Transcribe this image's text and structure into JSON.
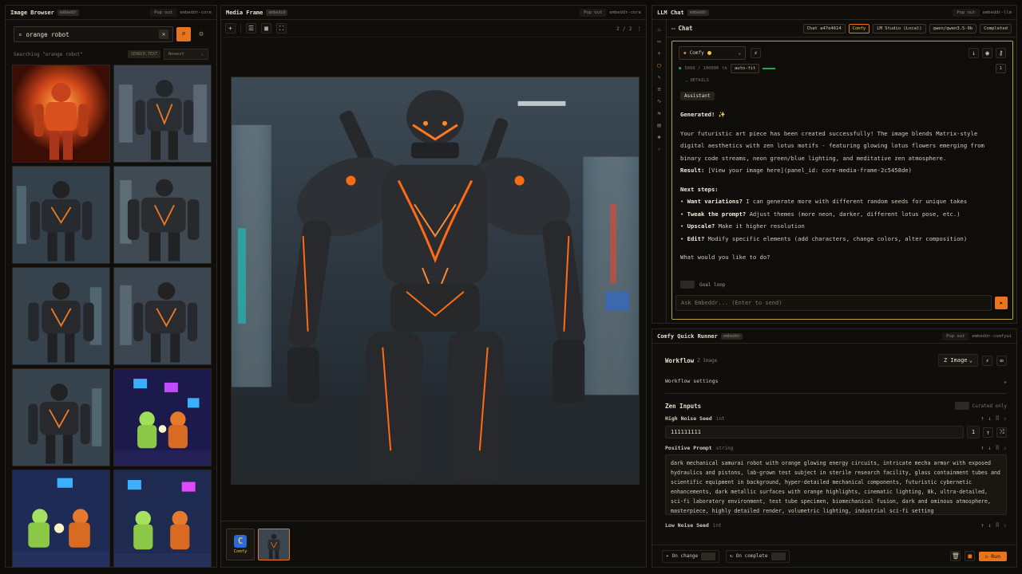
{
  "browser": {
    "title": "Image Browser",
    "tag": "embeddr",
    "pop_out": "Pop out",
    "source": "embeddr-core",
    "search_value": "orange robot",
    "status": "Searching \"orange robot\"",
    "mode_pill": "SEARCH.TEXT",
    "sort": "Newest"
  },
  "media": {
    "title": "Media Frame",
    "tag": "embedcd",
    "pop_out": "Pop out",
    "source": "embeddr-core",
    "counter": "2 / 2",
    "comfy_label": "Comfy"
  },
  "chat": {
    "title": "LLM Chat",
    "tag": "embeddr",
    "pop_out": "Pop out",
    "source": "embeddr-llm",
    "header": "Chat",
    "chips": [
      "Chat a47e4614",
      "Comfy",
      "LM Studio (Local)",
      "qwen/qwen3.5-9b",
      "Completed"
    ],
    "model": "Comfy",
    "tokens": "5099 / 100000",
    "tokens_unit": "tk",
    "auto_fit": "auto-fit",
    "badge": "1",
    "details": "DETAILS",
    "role": "Assistant",
    "generated": "Generated! ✨",
    "p1": "Your futuristic art piece has been created successfully! The image blends Matrix-style digital aesthetics with zen lotus motifs - featuring glowing lotus flowers emerging from binary code streams, neon green/blue lighting, and meditative zen atmosphere.",
    "result_label": "Result:",
    "result_text": "[View your image here](panel_id: core-media-frame-2c5458de)",
    "next_steps": "Next steps:",
    "steps": [
      {
        "b": "Want variations?",
        "t": "I can generate more with different random seeds for unique takes"
      },
      {
        "b": "Tweak the prompt?",
        "t": "Adjust themes (more neon, darker, different lotus pose, etc.)"
      },
      {
        "b": "Upscale?",
        "t": "Make it higher resolution"
      },
      {
        "b": "Edit?",
        "t": "Modify specific elements (add characters, change colors, alter composition)"
      }
    ],
    "question": "What would you like to do?",
    "goal_loop": "Goal loop",
    "placeholder": "Ask Embeddr... (Enter to send)"
  },
  "runner": {
    "title": "Comfy Quick Runner",
    "tag": "embeddr",
    "pop_out": "Pop out",
    "source": "embeddr-comfyui",
    "workflow_label": "Workflow",
    "workflow_sub": "Z Image",
    "workflow_select": "Z Image",
    "workflow_settings": "Workflow settings",
    "zen_inputs": "Zen Inputs",
    "curated_only": "Curated only",
    "high_seed_label": "High Noise Seed",
    "high_seed_type": "int",
    "high_seed_value": "111111111",
    "seed_step": "1",
    "positive_label": "Positive Prompt",
    "positive_type": "string",
    "positive_value": "dark mechanical samurai robot with orange glowing energy circuits, intricate mecha armor with exposed hydraulics and pistons, lab-grown test subject in sterile research facility, glass containment tubes and scientific equipment in background, hyper-detailed mechanical components, futuristic cybernetic enhancements, dark metallic surfaces with orange highlights, cinematic lighting, 8k, ultra-detailed, sci-fi laboratory environment, test tube specimen, biomechanical fusion, dark and ominous atmosphere, masterpiece, highly detailed render, volumetric lighting, industrial sci-fi setting",
    "low_seed_label": "Low Noise Seed",
    "low_seed_type": "int",
    "on_change": "On change",
    "on_complete": "On complete",
    "run": "Run"
  }
}
